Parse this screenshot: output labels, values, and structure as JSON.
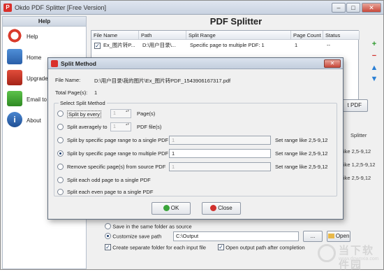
{
  "window": {
    "title": "Okdo PDF Splitter [Free Version]",
    "minimize": "–",
    "maximize": "□",
    "close": "✕"
  },
  "sidebar": {
    "header": "Help",
    "items": [
      {
        "label": "Help",
        "icon": "lifebuoy-icon"
      },
      {
        "label": "Home",
        "icon": "home-icon"
      },
      {
        "label": "Upgrade to",
        "icon": "shopping-cart-icon"
      },
      {
        "label": "Email to Sup",
        "icon": "email-icon"
      },
      {
        "label": "About",
        "icon": "info-icon"
      }
    ]
  },
  "main": {
    "title": "PDF Splitter",
    "table": {
      "columns": [
        "File Name",
        "Path",
        "Split Range",
        "Page Count",
        "Status"
      ],
      "rows": [
        {
          "file_name": "Ex_图片转P...",
          "path": "D:\\用户目录\\...",
          "split_range": "Specific page to multiple PDF: 1",
          "page_count": "1",
          "status": "--"
        }
      ]
    },
    "split_button": "t PDF",
    "bg_fragments": [
      "Splitter",
      "ike 2,5-9,12",
      "ike 1,2;5-9,12",
      "ike 2,5-9,12"
    ],
    "output": {
      "same_folder_label": "Save in the same folder as source",
      "customize_label": "Customize save path",
      "path_value": "C:\\Output",
      "browse_label": "...",
      "open_label": "Open",
      "separate_folder_label": "Create separate folder for each input file",
      "open_after_label": "Open output path after completion"
    }
  },
  "dialog": {
    "title": "Split Method",
    "file_name_label": "File Name:",
    "file_name_value": "D:\\用户目录\\我的图片\\Ex_图片转PDF_1543906167317.pdf",
    "total_pages_label": "Total Page(s):",
    "total_pages_value": "1",
    "group_title": "Select Split Method",
    "methods": [
      {
        "label": "Split by every",
        "spin": "1",
        "suffix": "Page(s)",
        "selected": false
      },
      {
        "label": "Split averagely to",
        "spin": "1",
        "suffix": "PDF file(s)",
        "selected": false
      },
      {
        "label": "Split by specific page range to a single PDF",
        "input": "1",
        "hint": "Set range like 2,5-9,12",
        "selected": false
      },
      {
        "label": "Split by specific page range to multiple PDF",
        "input": "1",
        "hint": "Set range like 2,5-9,12",
        "selected": true
      },
      {
        "label": "Remove specific page(s) from source PDF",
        "input": "1",
        "hint": "Set range like 2,5-9,12",
        "selected": false
      },
      {
        "label": "Split each odd page to a single PDF",
        "selected": false
      },
      {
        "label": "Split each even page to a single PDF",
        "selected": false
      }
    ],
    "ok_label": "OK",
    "close_label": "Close"
  },
  "watermark": {
    "text1": "当下软件园",
    "text2": "www.downxia.com"
  }
}
